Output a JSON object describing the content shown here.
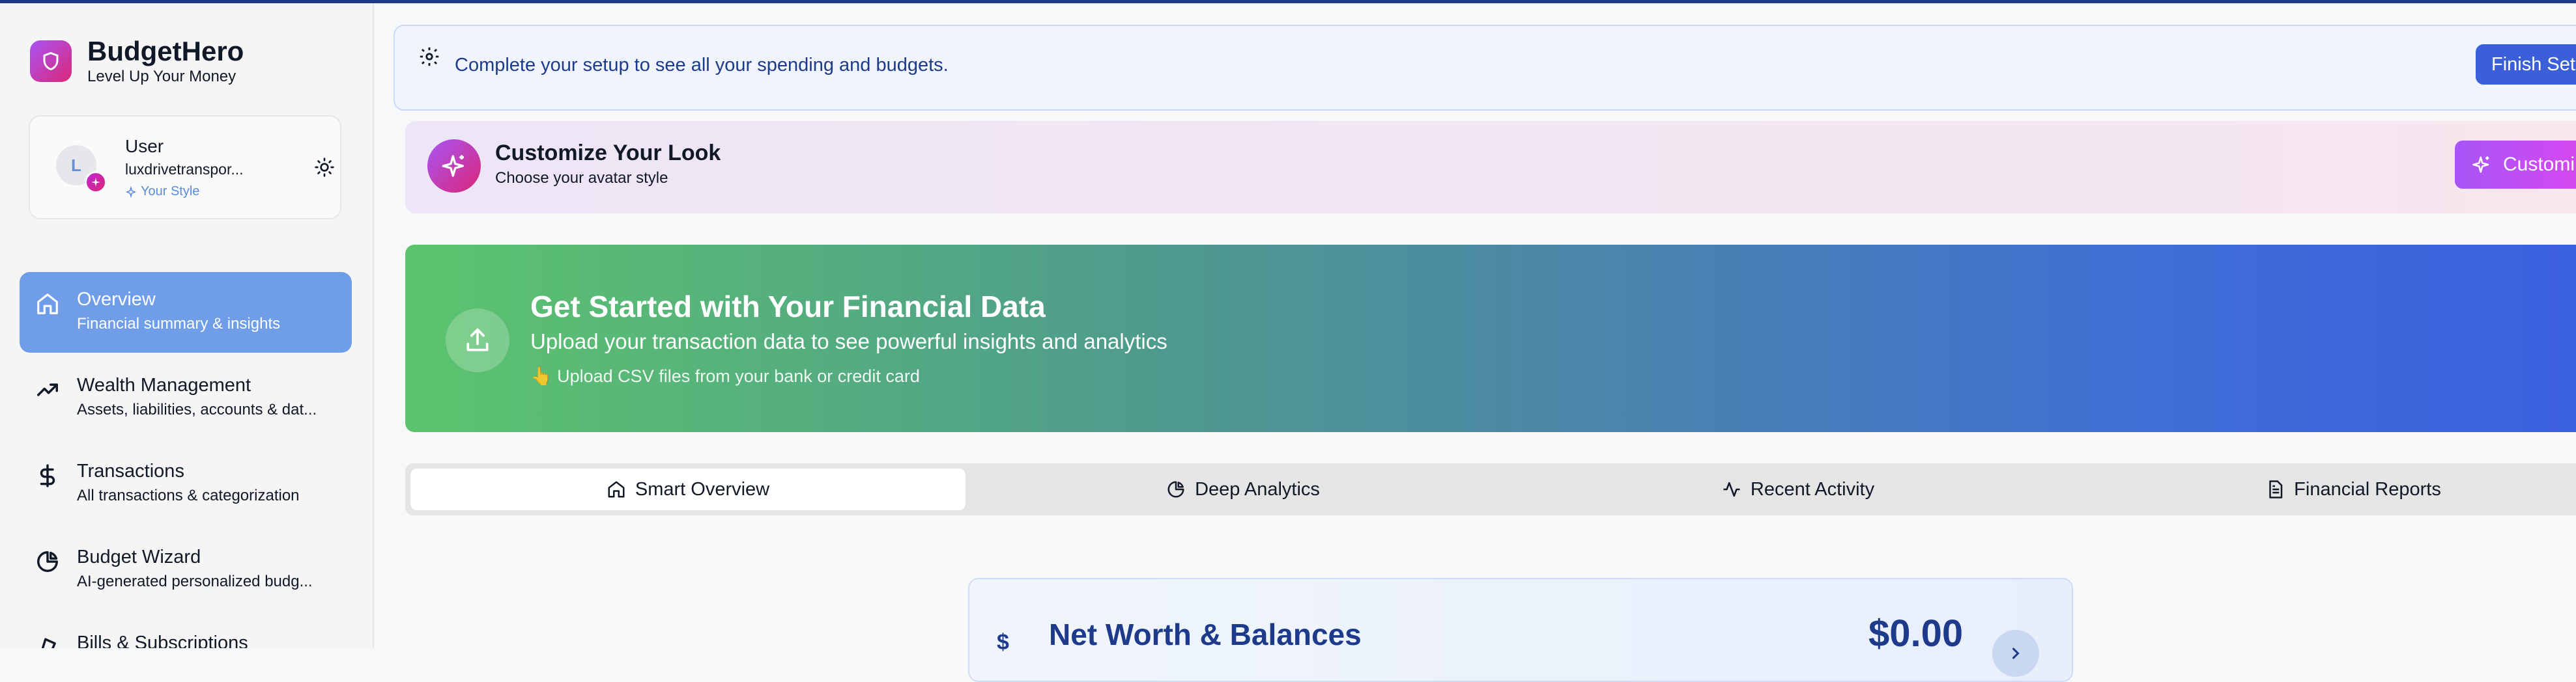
{
  "app": {
    "name": "BudgetHero",
    "tagline": "Level Up Your Money"
  },
  "user": {
    "name": "User",
    "initial": "L",
    "email": "luxdrivetranspor...",
    "style_label": "Your Style"
  },
  "nav": [
    {
      "label": "Overview",
      "desc": "Financial summary & insights",
      "icon": "home-icon",
      "active": true
    },
    {
      "label": "Wealth Management",
      "desc": "Assets, liabilities, accounts & dat...",
      "icon": "trending-up-icon",
      "active": false
    },
    {
      "label": "Transactions",
      "desc": "All transactions & categorization",
      "icon": "dollar-icon",
      "active": false
    },
    {
      "label": "Budget Wizard",
      "desc": "AI-generated personalized budg...",
      "icon": "pie-chart-icon",
      "active": false
    },
    {
      "label": "Bills & Subscriptions",
      "desc": "",
      "icon": "bill-icon",
      "active": false
    }
  ],
  "setup_banner": {
    "text": "Complete your setup to see all your spending and budgets.",
    "button": "Finish Set"
  },
  "customize": {
    "title": "Customize Your Look",
    "subtitle": "Choose your avatar style",
    "button": "Customi"
  },
  "hero": {
    "title": "Get Started with Your Financial Data",
    "subtitle": "Upload your transaction data to see powerful insights and analytics",
    "hint": "👆 Upload CSV files from your bank or credit card"
  },
  "tabs": [
    {
      "label": "Smart Overview",
      "icon": "home-icon",
      "active": true
    },
    {
      "label": "Deep Analytics",
      "icon": "pie-chart-icon",
      "active": false
    },
    {
      "label": "Recent Activity",
      "icon": "activity-icon",
      "active": false
    },
    {
      "label": "Financial Reports",
      "icon": "document-icon",
      "active": false
    }
  ],
  "net_worth": {
    "title": "Net Worth & Balances",
    "value": "$0.00",
    "icon": "dollar-icon"
  },
  "colors": {
    "accent": "#6f9de8",
    "brand_gradient_start": "#a855f7",
    "brand_gradient_end": "#db2777",
    "dark_blue": "#1e3a8a"
  }
}
